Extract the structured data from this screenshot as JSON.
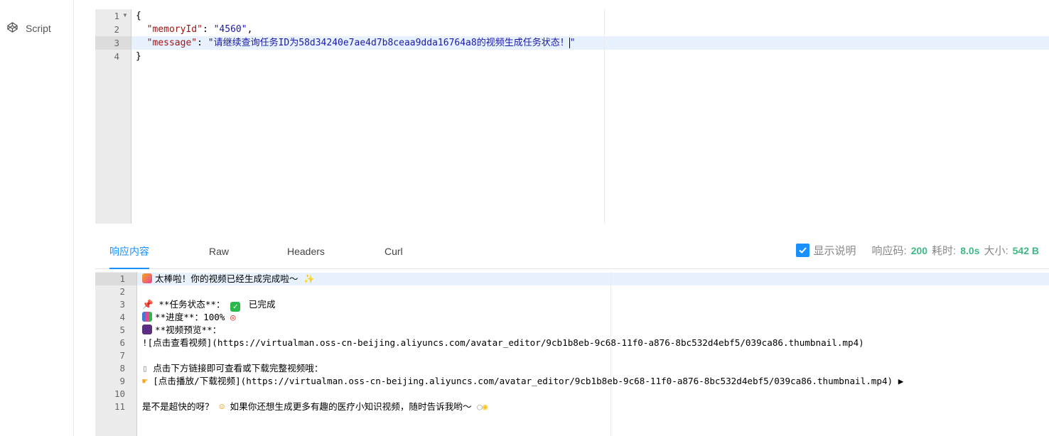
{
  "sidebar": {
    "items": [
      {
        "label": "Script",
        "icon": "codepen-icon"
      }
    ]
  },
  "request_editor": {
    "line_numbers": [
      "1",
      "2",
      "3",
      "4"
    ],
    "lines": {
      "l1": "{",
      "l2_key": "\"memoryId\"",
      "l2_sep": ": ",
      "l2_val": "\"4560\"",
      "l2_end": ",",
      "l3_key": "\"message\"",
      "l3_sep": ": ",
      "l3_val": "\"请继续查询任务ID为58d34240e7ae4d7b8ceaa9dda16764a8的视频生成任务状态！",
      "l3_end": "\"",
      "l4": "}"
    }
  },
  "response_tabs": [
    {
      "label": "响应内容",
      "active": true
    },
    {
      "label": "Raw",
      "active": false
    },
    {
      "label": "Headers",
      "active": false
    },
    {
      "label": "Curl",
      "active": false
    }
  ],
  "stats": {
    "show_description_label": "显示说明",
    "show_description_checked": true,
    "status_label": "响应码:",
    "status_value": "200",
    "time_label": "耗时:",
    "time_value": "8.0s",
    "size_label": "大小:",
    "size_value": "542 B"
  },
  "response_editor": {
    "line_numbers": [
      "1",
      "2",
      "3",
      "4",
      "5",
      "6",
      "7",
      "8",
      "9",
      "10",
      "11"
    ],
    "lines": {
      "l1": "太棒啦！你的视频已经生成完成啦～",
      "l3a": "**任务状态**：",
      "l3b": "已完成",
      "l4a": "**进度**：100%",
      "l5": "**视频预览**：",
      "l6": "![点击查看视频](https://virtualman.oss-cn-beijing.aliyuncs.com/avatar_editor/9cb1b8eb-9c68-11f0-a876-8bc532d4ebf5/039ca86.thumbnail.mp4)",
      "l8": "点击下方链接即可查看或下载完整视频哦：",
      "l9": "[点击播放/下载视频](https://virtualman.oss-cn-beijing.aliyuncs.com/avatar_editor/9cb1b8eb-9c68-11f0-a876-8bc532d4ebf5/039ca86.thumbnail.mp4)",
      "l11a": "是不是超快的呀？",
      "l11b": "如果你还想生成更多有趣的医疗小知识视频，随时告诉我哟～"
    },
    "emoji_icons": [
      "party-popper-icon",
      "sparkles-icon",
      "pushpin-icon",
      "check-mark-icon",
      "bar-chart-icon",
      "target-icon",
      "clapper-icon",
      "mouse-icon",
      "pointing-hand-icon",
      "movie-camera-icon",
      "smiling-face-icon",
      "speech-bubble-icon",
      "light-bulb-icon"
    ]
  }
}
